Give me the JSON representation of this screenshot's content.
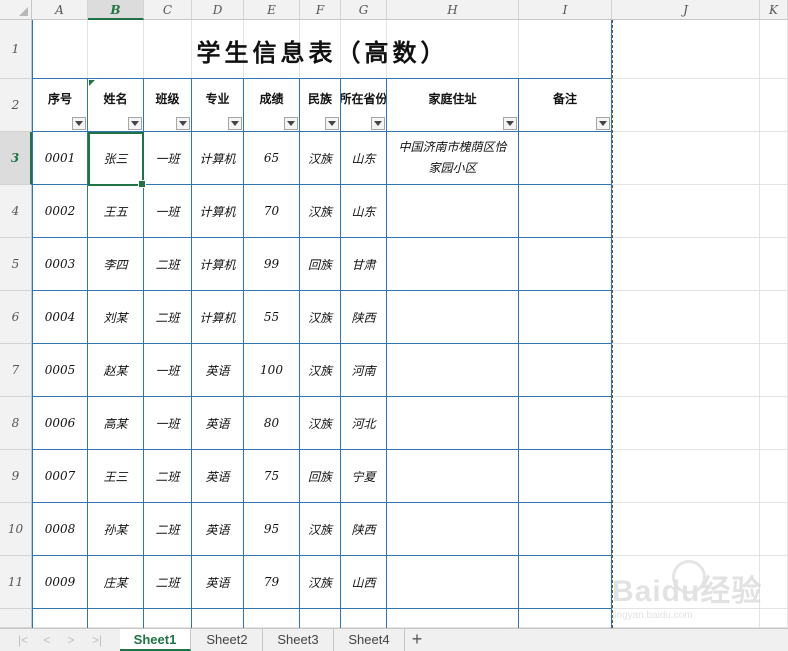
{
  "columns": [
    "A",
    "B",
    "C",
    "D",
    "E",
    "F",
    "G",
    "H",
    "I",
    "J",
    "K"
  ],
  "rows": [
    "1",
    "2",
    "3",
    "4",
    "5",
    "6",
    "7",
    "8",
    "9",
    "10",
    "11"
  ],
  "selected_column": "B",
  "selected_row": "3",
  "title": "学生信息表（高数）",
  "headers": [
    "序号",
    "姓名",
    "班级",
    "专业",
    "成绩",
    "民族",
    "所在省份",
    "家庭住址",
    "备注"
  ],
  "records": [
    {
      "id": "0001",
      "name": "张三",
      "cls": "一班",
      "major": "计算机",
      "score": "65",
      "nation": "汉族",
      "province": "山东",
      "address": "中国济南市槐荫区恰家园小区",
      "note": ""
    },
    {
      "id": "0002",
      "name": "王五",
      "cls": "一班",
      "major": "计算机",
      "score": "70",
      "nation": "汉族",
      "province": "山东",
      "address": "",
      "note": ""
    },
    {
      "id": "0003",
      "name": "李四",
      "cls": "二班",
      "major": "计算机",
      "score": "99",
      "nation": "回族",
      "province": "甘肃",
      "address": "",
      "note": ""
    },
    {
      "id": "0004",
      "name": "刘某",
      "cls": "二班",
      "major": "计算机",
      "score": "55",
      "nation": "汉族",
      "province": "陕西",
      "address": "",
      "note": ""
    },
    {
      "id": "0005",
      "name": "赵某",
      "cls": "一班",
      "major": "英语",
      "score": "100",
      "nation": "汉族",
      "province": "河南",
      "address": "",
      "note": ""
    },
    {
      "id": "0006",
      "name": "高某",
      "cls": "一班",
      "major": "英语",
      "score": "80",
      "nation": "汉族",
      "province": "河北",
      "address": "",
      "note": ""
    },
    {
      "id": "0007",
      "name": "王三",
      "cls": "二班",
      "major": "英语",
      "score": "75",
      "nation": "回族",
      "province": "宁夏",
      "address": "",
      "note": ""
    },
    {
      "id": "0008",
      "name": "孙某",
      "cls": "二班",
      "major": "英语",
      "score": "95",
      "nation": "汉族",
      "province": "陕西",
      "address": "",
      "note": ""
    },
    {
      "id": "0009",
      "name": "庄某",
      "cls": "二班",
      "major": "英语",
      "score": "79",
      "nation": "汉族",
      "province": "山西",
      "address": "",
      "note": ""
    }
  ],
  "sheet_tabs": [
    "Sheet1",
    "Sheet2",
    "Sheet3",
    "Sheet4"
  ],
  "active_sheet": "Sheet1",
  "add_sheet_label": "+",
  "nav_arrows": [
    "|<",
    "<",
    ">",
    ">|"
  ],
  "watermark": {
    "brand": "Baidu经验",
    "url": "jingyan.baidu.com"
  },
  "colors": {
    "accent": "#217346",
    "border": "#2e75b6"
  }
}
